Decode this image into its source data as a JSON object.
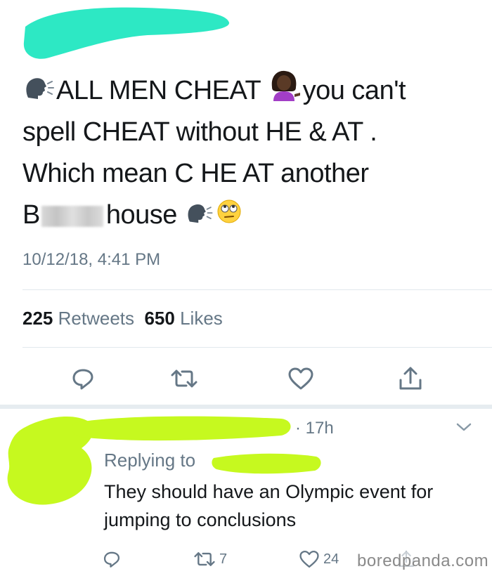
{
  "tweet": {
    "line1_text_a": "ALL MEN CHEAT",
    "line1_text_b": "you can't",
    "line2": "spell CHEAT without HE & AT .",
    "line3": "Which mean C HE AT another",
    "line4_start": "B",
    "line4_end": "house",
    "timestamp": "10/12/18, 4:41 PM"
  },
  "stats": {
    "retweets_count": "225",
    "retweets_label": "Retweets",
    "likes_count": "650",
    "likes_label": "Likes"
  },
  "reply": {
    "time": "· 17h",
    "replying_to_label": "Replying to",
    "text": "They should have an Olympic event for jumping to conclusions",
    "retweets": "7",
    "likes": "24"
  },
  "watermark": "boredpanda.com",
  "colors": {
    "redaction_cyan": "#2de8c4",
    "redaction_lime": "#c6f91f",
    "text_primary": "#14171a",
    "text_secondary": "#657786"
  },
  "icons": {
    "speaking_head": "speaking-head-icon",
    "woman_tipping_hand": "woman-tipping-hand-icon",
    "rolling_eyes": "face-rolling-eyes-icon",
    "reply": "reply-icon",
    "retweet": "retweet-icon",
    "like": "heart-icon",
    "share": "share-icon",
    "chevron": "chevron-down-icon"
  }
}
